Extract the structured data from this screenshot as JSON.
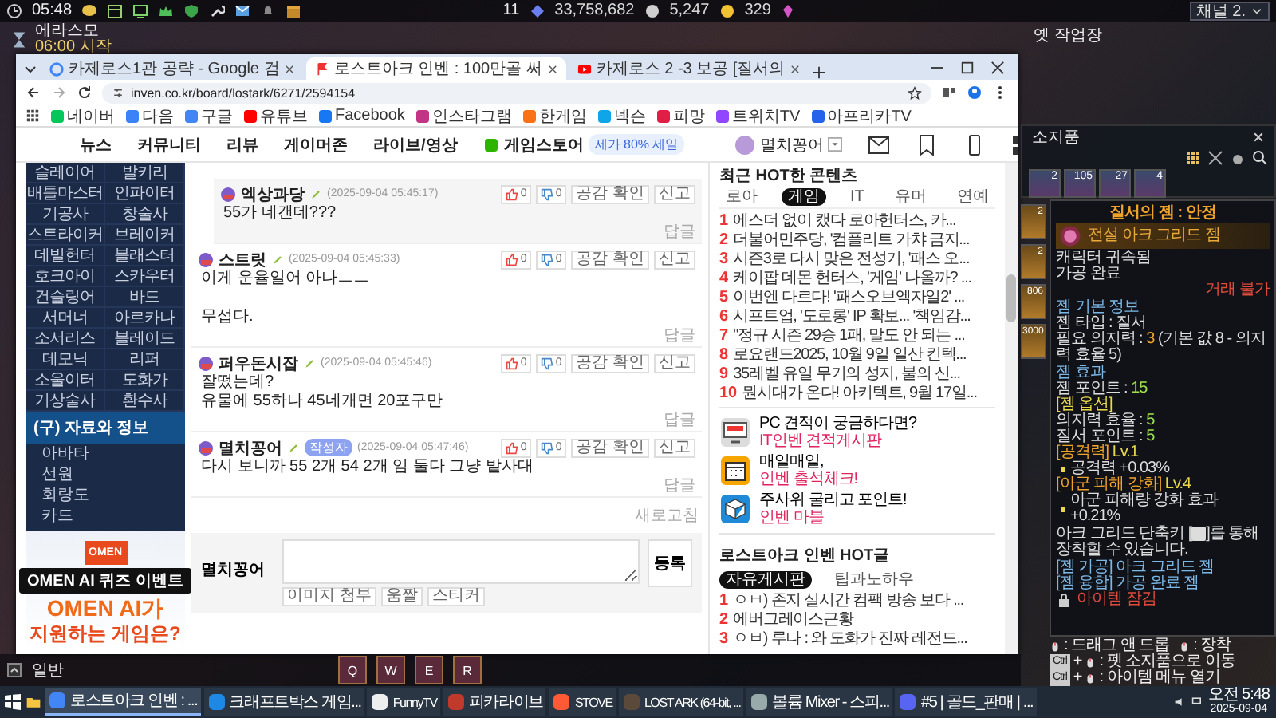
{
  "game_hud": {
    "time": "05:48",
    "level": "11",
    "silver": "33,758,682",
    "gold": "5,247",
    "crystals": "329",
    "channel": "채널 2.",
    "region": "옛 작업장",
    "event_title": "에라스모",
    "event_time": "06:00 시작"
  },
  "browser": {
    "tabs": [
      {
        "title": "카제로스1관 공략 - Google 검",
        "kind": "google",
        "selected": false
      },
      {
        "title": "로스트아크 인벤 : 100만골 써",
        "kind": "inven",
        "selected": true
      },
      {
        "title": "카제로스 2 -3 보공 [질서의",
        "kind": "youtube",
        "selected": false
      }
    ],
    "url": "inven.co.kr/board/lostark/6271/2594154",
    "bookmarks": [
      {
        "label": "네이버",
        "color": "#03c75a"
      },
      {
        "label": "다음",
        "color": "#3b82f6"
      },
      {
        "label": "구글",
        "color": "#4285f4"
      },
      {
        "label": "유튜브",
        "color": "#ff0000"
      },
      {
        "label": "Facebook",
        "color": "#1877f2"
      },
      {
        "label": "인스타그램",
        "color": "#c13584"
      },
      {
        "label": "한게임",
        "color": "#f97316"
      },
      {
        "label": "넥슨",
        "color": "#0ea5e9"
      },
      {
        "label": "피망",
        "color": "#e11d48"
      },
      {
        "label": "트위치TV",
        "color": "#9146ff"
      },
      {
        "label": "아프리카TV",
        "color": "#2563eb"
      }
    ]
  },
  "site_nav": {
    "items": [
      "뉴스",
      "커뮤니티",
      "리뷰",
      "게이머존",
      "라이브/영상",
      "게임스토어"
    ],
    "store_badge": "세가 80% 세일",
    "user": "멸치꽁어"
  },
  "sidebar": {
    "classes": [
      "슬레이어",
      "발키리",
      "배틀마스터",
      "인파이터",
      "기공사",
      "창술사",
      "스트라이커",
      "브레이커",
      "데빌헌터",
      "블래스터",
      "호크아이",
      "스카우터",
      "건슬링어",
      "바드",
      "서머너",
      "아르카나",
      "소서리스",
      "블레이드",
      "데모닉",
      "리퍼",
      "소울이터",
      "도화가",
      "기상술사",
      "환수사"
    ],
    "section": "(구) 자료와 정보",
    "links": [
      "아바타",
      "선원",
      "회랑도",
      "카드"
    ],
    "ad": {
      "logo": "OMEN",
      "banner": "OMEN AI 퀴즈 이벤트",
      "headline": "OMEN AI가",
      "subline": "지원하는 게임은?"
    }
  },
  "comments": [
    {
      "kind": "reply",
      "author": "엑상과당",
      "date": "(2025-09-04 05:45:17)",
      "paragraphs": [
        "55가 네갠데???"
      ],
      "likes": "0",
      "dislikes": "0",
      "actions": [
        "공감 확인",
        "신고"
      ],
      "reply_label": "답글"
    },
    {
      "kind": "comment",
      "author": "스트릿",
      "date": "(2025-09-04 05:45:33)",
      "paragraphs": [
        "이게 운율일어 아나ㅡㅡ",
        "무섭다."
      ],
      "likes": "0",
      "dislikes": "0",
      "actions": [
        "공감 확인",
        "신고"
      ],
      "reply_label": "답글"
    },
    {
      "kind": "comment",
      "author": "퍼우돈시잡",
      "date": "(2025-09-04 05:45:46)",
      "paragraphs": [
        "잘떴는데?\n유물에 55하나 45네개면 20포구만"
      ],
      "likes": "0",
      "dislikes": "0",
      "actions": [
        "공감 확인",
        "신고"
      ],
      "reply_label": "답글"
    },
    {
      "kind": "comment",
      "author": "멸치꽁어",
      "tag": "작성자",
      "date": "(2025-09-04 05:47:46)",
      "paragraphs": [
        "다시 보니까 55 2개 54 2개 임 둘다 그냥 밭사대"
      ],
      "likes": "0",
      "dislikes": "0",
      "actions": [
        "공감 확인",
        "신고"
      ],
      "reply_label": "답글"
    }
  ],
  "refresh": "새로고침",
  "comment_form": {
    "author": "멸치꽁어",
    "submit": "등록",
    "tools": [
      "이미지 첨부",
      "움짤",
      "스티커"
    ]
  },
  "hot": {
    "title": "최근 HOT한 콘텐츠",
    "tabs": [
      {
        "label": "로아",
        "selected": false
      },
      {
        "label": "게임",
        "selected": true
      },
      {
        "label": "IT",
        "selected": false
      },
      {
        "label": "유머",
        "selected": false
      },
      {
        "label": "연예",
        "selected": false
      }
    ],
    "items": [
      {
        "rank": "1",
        "title": "에스더 없이 캤다 로아헌터스, 카..."
      },
      {
        "rank": "2",
        "title": "더불어민주당, '컴플리트 가챠 금지..."
      },
      {
        "rank": "3",
        "title": "시즌3로 다시 맞은 전성기, '패스 오..."
      },
      {
        "rank": "4",
        "title": "케이팝 데몬 헌터스, '게임' 나올까? ..."
      },
      {
        "rank": "5",
        "title": "이번엔 다르다! '패스오브엑자일2' ..."
      },
      {
        "rank": "6",
        "title": "시프트업, '도로롱' IP 확보... '책임감..."
      },
      {
        "rank": "7",
        "title": "\"정규 시즌 29승 1패, 말도 안 되는 ..."
      },
      {
        "rank": "8",
        "title": "로요랜드2025, 10월 9일 일산 킨텍..."
      },
      {
        "rank": "9",
        "title": "35레벨 유일 무기의 성지, 불의 신..."
      },
      {
        "rank": "10",
        "title": "뭔시대가 온다! 아키텍트, 9월 17일..."
      }
    ]
  },
  "promos": [
    {
      "kind": "monitor",
      "title": "PC 견적이 궁금하다면?",
      "link": "IT인벤 견적게시판"
    },
    {
      "kind": "calendar",
      "title": "매일매일,",
      "link": "인벤 출석체크!"
    },
    {
      "kind": "dice",
      "title": "주사위 굴리고 포인트!",
      "link": "인벤 마블"
    }
  ],
  "hot_posts": {
    "title": "로스트아크 인벤 HOT글",
    "tabs": [
      {
        "label": "자유게시판",
        "selected": true
      },
      {
        "label": "팁과노하우",
        "selected": false
      }
    ],
    "items": [
      {
        "rank": "1",
        "title": "ㅇㅂ) 존지 실시간 컴팩 방송 보다 ..."
      },
      {
        "rank": "2",
        "title": "에버그레이스근황"
      },
      {
        "rank": "3",
        "title": "ㅇㅂ) 루나 : 와 도화가 진짜 레전드..."
      }
    ]
  },
  "inventory": {
    "title": "소지품",
    "top_slots": [
      "2",
      "105",
      "27",
      "4"
    ],
    "side_slots": [
      "2",
      "2",
      "806",
      "3000"
    ]
  },
  "tooltip": {
    "title": "질서의 젬 : 안정",
    "grade": "전설 아크 그리드 젬",
    "lines": [
      {
        "kind": "text",
        "text": "캐릭터 귀속됨"
      },
      {
        "kind": "text",
        "text": "가공 완료"
      },
      {
        "kind": "warning",
        "text": "거래 불가"
      },
      {
        "kind": "heading",
        "text": "젬 기본 정보"
      },
      {
        "kind": "text",
        "text": "젬 타입 : 질서"
      },
      {
        "kind": "requirement",
        "label": "필요 의지력 : ",
        "value": "3",
        "note": " (기본 값 8 - 의지력 효율 5)"
      },
      {
        "kind": "heading",
        "text": "젬 효과"
      },
      {
        "kind": "stat",
        "label": "젬 포인트 : ",
        "value": "15"
      },
      {
        "kind": "section",
        "text": "[젬 옵션]"
      },
      {
        "kind": "stat",
        "label": "의지력 효율 : ",
        "value": "5"
      },
      {
        "kind": "stat",
        "label": "질서 포인트 : ",
        "value": "5"
      },
      {
        "kind": "option",
        "label": "[공격력] ",
        "value": "Lv.1"
      },
      {
        "kind": "bullet",
        "text": "공격력 +0.03%"
      },
      {
        "kind": "option",
        "label": "[아군 피해 강화] ",
        "value": "Lv.4"
      },
      {
        "kind": "bullet",
        "text": "아군 피해량 강화 효과 +0.21%"
      },
      {
        "kind": "keyhint",
        "before": "아크 그리드 단축키 [",
        "after": "]를 통해 장착할 수 있습니다."
      },
      {
        "kind": "link",
        "text": "[젬 가공] 아크 그리드 젬"
      },
      {
        "kind": "link",
        "text": "[젬 융합] 가공 완료 젬"
      },
      {
        "kind": "locked",
        "text": "아이템 잠김"
      }
    ]
  },
  "key_hints": [
    {
      "kind": "mouse",
      "text": ": 드래그 앤 드롭"
    },
    {
      "kind": "mouse",
      "text": ": 장착"
    },
    {
      "kind": "ctrl",
      "key": "Ctrl",
      "joiner": "+",
      "text": ": 펫 소지품으로 이동"
    },
    {
      "kind": "ctrl",
      "key": "Ctrl",
      "joiner": "+",
      "text": ": 아이템 메뉴 열기"
    }
  ],
  "chat": {
    "channel": "일반"
  },
  "skills": [
    {
      "key": "Q"
    },
    {
      "key": "W"
    },
    {
      "key": "E"
    },
    {
      "key": "R"
    }
  ],
  "taskbar": {
    "tasks": [
      {
        "kind": "chrome",
        "label": "로스트아크 인벤 : ...",
        "selected": true
      },
      {
        "kind": "craft",
        "label": "크래프트박스 게임...",
        "selected": false
      },
      {
        "kind": "funny",
        "label": "FunnyTV",
        "selected": false
      },
      {
        "kind": "pika",
        "label": "피카라이브",
        "selected": false
      },
      {
        "kind": "stove",
        "label": "STOVE",
        "selected": false
      },
      {
        "kind": "lostark",
        "label": "LOST ARK (64-bit, ...",
        "selected": false
      },
      {
        "kind": "mixer",
        "label": "볼륨 Mixer - 스피...",
        "selected": false
      },
      {
        "kind": "discord",
        "label": "#5 | 골드_판매 | ...",
        "selected": false
      }
    ],
    "time": "오전 5:48",
    "date": "2025-09-04"
  }
}
